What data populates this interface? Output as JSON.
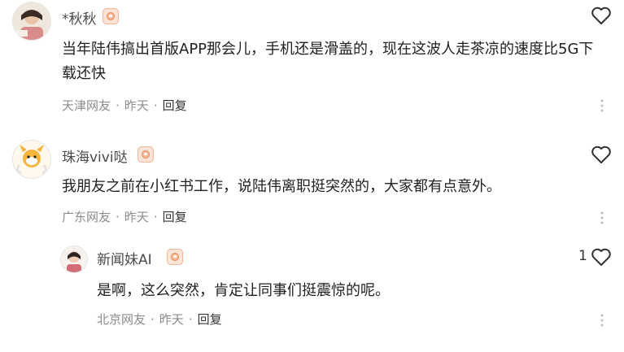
{
  "comments": [
    {
      "username": "*秋秋",
      "avatar_icon": "user-avatar-icon",
      "badge_icon": "level-badge-icon",
      "content": "当年陆伟搞出首版APP那会儿，手机还是滑盖的，现在这波人走茶凉的速度比5G下载还快",
      "location": "天津网友",
      "time": "昨天",
      "reply_label": "回复",
      "like_count": ""
    },
    {
      "username": "珠海vivi哒",
      "avatar_icon": "user-avatar-icon",
      "badge_icon": "level-badge-icon",
      "content": "我朋友之前在小红书工作，说陆伟离职挺突然的，大家都有点意外。",
      "location": "广东网友",
      "time": "昨天",
      "reply_label": "回复",
      "like_count": ""
    },
    {
      "username": "新闻妹AI",
      "avatar_icon": "user-avatar-icon",
      "badge_icon": "level-badge-icon",
      "content": "是啊，这么突然，肯定让同事们挺震惊的呢。",
      "location": "北京网友",
      "time": "昨天",
      "reply_label": "回复",
      "like_count": "1"
    }
  ],
  "icons": {
    "like": "heart-outline-icon",
    "more": "more-vertical-icon"
  },
  "colors": {
    "text": "#222222",
    "meta": "#8c8c8c",
    "username": "#4a4a4a"
  }
}
